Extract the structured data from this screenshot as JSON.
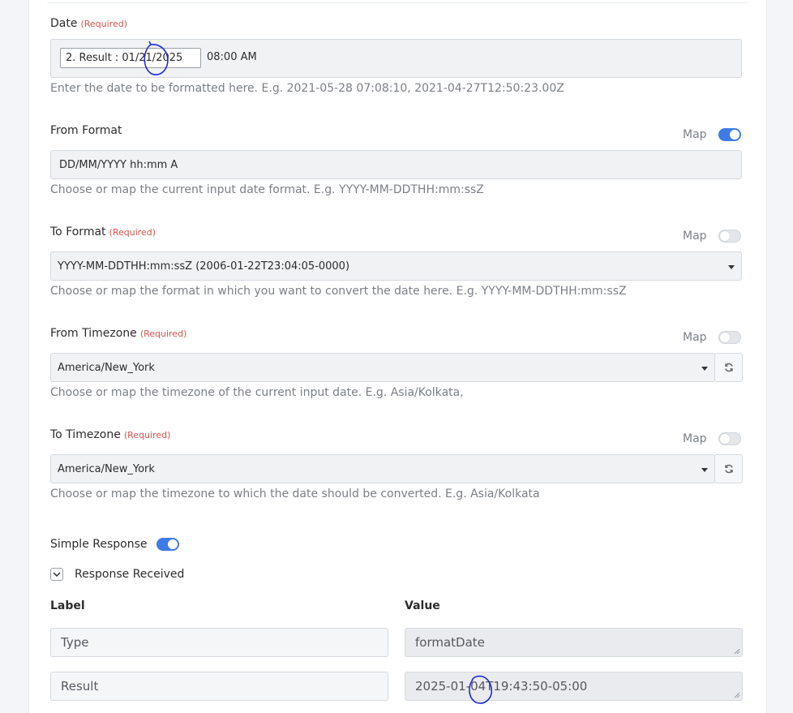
{
  "date": {
    "label": "Date",
    "required": "(Required)",
    "chip_text": "2. Result : 01/21/2025",
    "extra_text": "08:00 AM",
    "help": "Enter the date to be formatted here. E.g. 2021-05-28 07:08:10, 2021-04-27T12:50:23.00Z"
  },
  "from_format": {
    "label": "From Format",
    "map_label": "Map",
    "map_on": true,
    "value": "DD/MM/YYYY hh:mm A",
    "help": "Choose or map the current input date format. E.g. YYYY-MM-DDTHH:mm:ssZ"
  },
  "to_format": {
    "label": "To Format",
    "required": "(Required)",
    "map_label": "Map",
    "map_on": false,
    "value": "YYYY-MM-DDTHH:mm:ssZ (2006-01-22T23:04:05-0000)",
    "help": "Choose or map the format in which you want to convert the date here. E.g. YYYY-MM-DDTHH:mm:ssZ"
  },
  "from_timezone": {
    "label": "From Timezone",
    "required": "(Required)",
    "map_label": "Map",
    "map_on": false,
    "value": "America/New_York",
    "help": "Choose or map the timezone of the current input date. E.g. Asia/Kolkata,"
  },
  "to_timezone": {
    "label": "To Timezone",
    "required": "(Required)",
    "map_label": "Map",
    "map_on": false,
    "value": "America/New_York",
    "help": "Choose or map the timezone to which the date should be converted. E.g. Asia/Kolkata"
  },
  "simple_response": {
    "label": "Simple Response",
    "on": true
  },
  "response_received": {
    "label": "Response Received"
  },
  "table": {
    "label_header": "Label",
    "value_header": "Value",
    "rows": [
      {
        "label": "Type",
        "value": "formatDate"
      },
      {
        "label": "Result",
        "value": "2025-01-04T19:43:50-05:00"
      }
    ]
  },
  "colors": {
    "accent": "#3f7be6",
    "required": "#d9534f",
    "annotation": "#1f2bd6"
  },
  "icons": [
    "refresh-icon",
    "chevron-down-icon",
    "caret-down-icon",
    "resize-grip-icon"
  ]
}
